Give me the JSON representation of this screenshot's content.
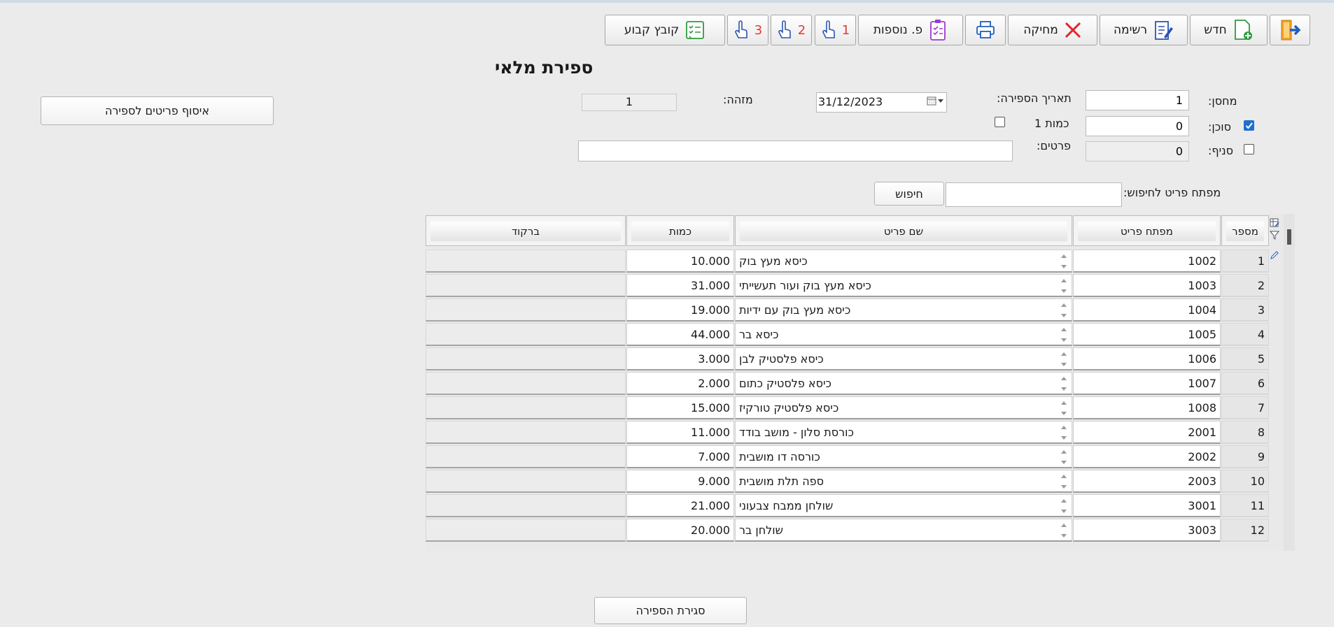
{
  "toolbar": {
    "exit": "",
    "new": "חדש",
    "list": "רשימה",
    "delete": "מחיקה",
    "print": "",
    "more": "פ. נוספות",
    "hand1": "1",
    "hand2": "2",
    "hand3": "3",
    "fixed_file": "קובץ קבוע"
  },
  "page_title": "ספירת מלאי",
  "form": {
    "warehouse_label": "מחסן:",
    "warehouse_value": "1",
    "agent_label": "סוכן:",
    "agent_value": "0",
    "agent_checked": true,
    "branch_label": "סניף:",
    "branch_value": "0",
    "branch_checked": false,
    "count_date_label": "תאריך הספירה:",
    "count_date_value": "31/12/2023",
    "qty1_label": "כמות 1",
    "qty1_checked": false,
    "items_label": "פרטים:",
    "items_value": "",
    "id_label": "מזהה:",
    "id_value": "1",
    "collect_items_button": "איסוף פריטים לספירה",
    "search_label": "מפתח פריט לחיפוש:",
    "search_value": "",
    "search_button": "חיפוש"
  },
  "table": {
    "columns": {
      "number": "מספר",
      "item_key": "מפתח פריט",
      "item_name": "שם פריט",
      "quantity": "כמות",
      "barcode": "ברקוד"
    },
    "rows": [
      {
        "n": "1",
        "key": "1002",
        "name": "כיסא מעץ בוק",
        "qty": "10.000",
        "barcode": ""
      },
      {
        "n": "2",
        "key": "1003",
        "name": "כיסא מעץ בוק ועור תעשייתי",
        "qty": "31.000",
        "barcode": ""
      },
      {
        "n": "3",
        "key": "1004",
        "name": "כיסא מעץ בוק עם ידיות",
        "qty": "19.000",
        "barcode": ""
      },
      {
        "n": "4",
        "key": "1005",
        "name": "כיסא בר",
        "qty": "44.000",
        "barcode": ""
      },
      {
        "n": "5",
        "key": "1006",
        "name": "כיסא פלסטיק לבן",
        "qty": "3.000",
        "barcode": ""
      },
      {
        "n": "6",
        "key": "1007",
        "name": "כיסא פלסטיק כתום",
        "qty": "2.000",
        "barcode": ""
      },
      {
        "n": "7",
        "key": "1008",
        "name": "כיסא פלסטיק טורקיז",
        "qty": "15.000",
        "barcode": ""
      },
      {
        "n": "8",
        "key": "2001",
        "name": "כורסת סלון - מושב בודד",
        "qty": "11.000",
        "barcode": ""
      },
      {
        "n": "9",
        "key": "2002",
        "name": "כורסה דו מושבית",
        "qty": "7.000",
        "barcode": ""
      },
      {
        "n": "10",
        "key": "2003",
        "name": "ספה תלת מושבית",
        "qty": "9.000",
        "barcode": ""
      },
      {
        "n": "11",
        "key": "3001",
        "name": "שולחן ממבח צבעוני",
        "qty": "21.000",
        "barcode": ""
      },
      {
        "n": "12",
        "key": "3003",
        "name": "שולחן בר",
        "qty": "20.000",
        "barcode": ""
      }
    ]
  },
  "close_button": "סגירת הספירה"
}
